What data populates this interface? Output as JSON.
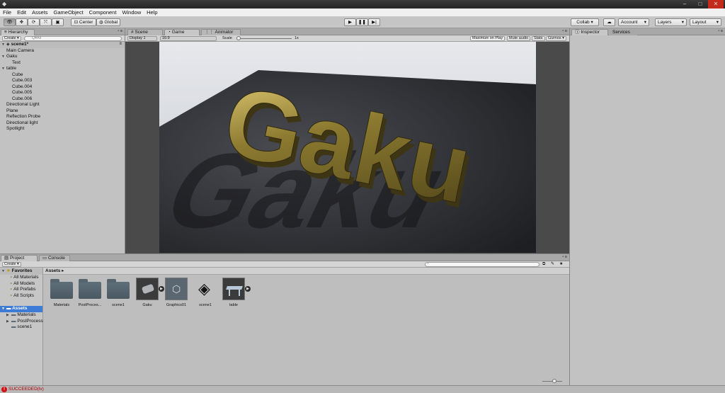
{
  "menu": [
    "File",
    "Edit",
    "Assets",
    "GameObject",
    "Component",
    "Window",
    "Help"
  ],
  "toolbar": {
    "pivot_label": "Center",
    "space_label": "Global",
    "collab_label": "Collab ▾",
    "account_label": "Account",
    "layers_label": "Layers",
    "layout_label": "Layout"
  },
  "hierarchy": {
    "tab": "Hierarchy",
    "create_label": "Create ▾",
    "search_placeholder": "Q▾All",
    "scene_name": "scene1*",
    "items": [
      {
        "label": "Main Camera",
        "depth": 1,
        "expand": false
      },
      {
        "label": "Gaku",
        "depth": 1,
        "expand": true
      },
      {
        "label": "Text",
        "depth": 2,
        "expand": false
      },
      {
        "label": "table",
        "depth": 1,
        "expand": true
      },
      {
        "label": "Cube",
        "depth": 2,
        "expand": false
      },
      {
        "label": "Cube.003",
        "depth": 2,
        "expand": false
      },
      {
        "label": "Cube.004",
        "depth": 2,
        "expand": false
      },
      {
        "label": "Cube.005",
        "depth": 2,
        "expand": false
      },
      {
        "label": "Cube.006",
        "depth": 2,
        "expand": false
      },
      {
        "label": "Directional Light",
        "depth": 1,
        "expand": false
      },
      {
        "label": "Plane",
        "depth": 1,
        "expand": false
      },
      {
        "label": "Reflection Probe",
        "depth": 1,
        "expand": false
      },
      {
        "label": "Directional light",
        "depth": 1,
        "expand": false
      },
      {
        "label": "Spotlight",
        "depth": 1,
        "expand": false
      }
    ]
  },
  "center_tabs": [
    "Scene",
    "Game",
    "Animator"
  ],
  "game": {
    "display": "Display 1",
    "aspect": "16:9",
    "scale_label": "Scale",
    "scale_value": "1x",
    "maximize_label": "Maximize on Play",
    "mute_label": "Mute audio",
    "stats_label": "Stats",
    "gizmos_label": "Gizmos ▾",
    "scene_text": "Gaku"
  },
  "right_tabs": [
    "Inspector",
    "Services"
  ],
  "project": {
    "tabs": [
      "Project",
      "Console"
    ],
    "create_label": "Create ▾",
    "favorites_label": "Favorites",
    "favorites": [
      "All Materials",
      "All Models",
      "All Prefabs",
      "All Scripts"
    ],
    "assets_root": "Assets",
    "assets_tree": [
      "Materials",
      "PostProcess",
      "scene1"
    ],
    "breadcrumb": "Assets ▸",
    "assets": [
      {
        "label": "Materials",
        "kind": "folder"
      },
      {
        "label": "PostProces...",
        "kind": "folder"
      },
      {
        "label": "scene1",
        "kind": "folder"
      },
      {
        "label": "Gaku",
        "kind": "model"
      },
      {
        "label": "Graphics01",
        "kind": "unity-light"
      },
      {
        "label": "scene1",
        "kind": "unity-scene"
      },
      {
        "label": "table",
        "kind": "model-table"
      }
    ]
  },
  "status": {
    "text": "SUCCEEDED(lv)"
  }
}
